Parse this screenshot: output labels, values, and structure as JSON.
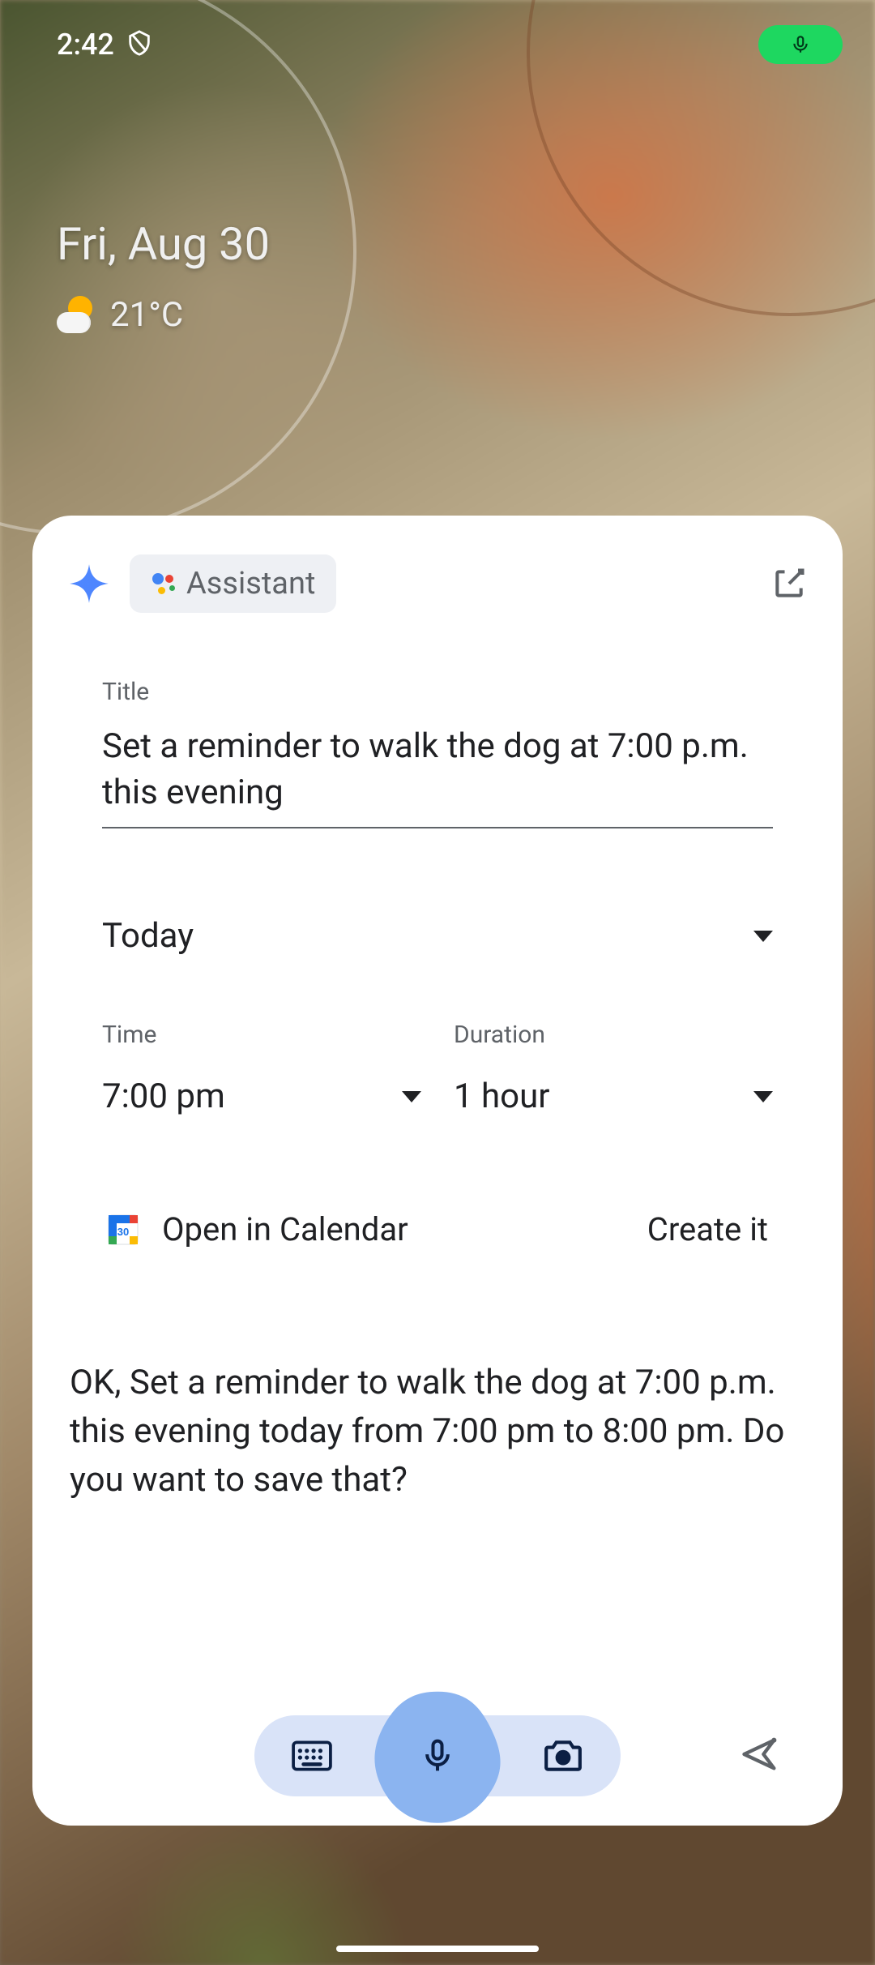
{
  "status": {
    "time": "2:42"
  },
  "home": {
    "date": "Fri, Aug 30",
    "temperature": "21°C"
  },
  "assistant": {
    "chip_label": "Assistant",
    "form": {
      "title_label": "Title",
      "title_value": "Set a reminder to walk the dog at 7:00 p.m. this evening",
      "date_value": "Today",
      "time_label": "Time",
      "time_value": "7:00 pm",
      "duration_label": "Duration",
      "duration_value": "1 hour",
      "open_calendar_label": "Open in Calendar",
      "create_label": "Create it"
    },
    "response": "OK, Set a reminder to walk the dog at 7:00 p.m. this evening today from 7:00 pm to 8:00 pm. Do you want to save that?"
  }
}
